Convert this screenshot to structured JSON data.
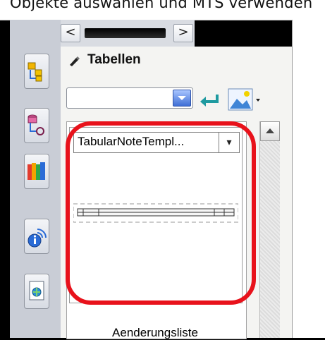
{
  "window": {
    "title": "Objekte auswählen und MTS verwenden"
  },
  "nav": {
    "back_label": "<",
    "forward_label": ">"
  },
  "sidebar": {
    "items": [
      {
        "name": "assembly-navigator-icon"
      },
      {
        "name": "constraint-navigator-icon"
      },
      {
        "name": "library-icon"
      },
      {
        "name": "info-icon"
      },
      {
        "name": "web-browser-icon"
      }
    ]
  },
  "panel": {
    "title": "Tabellen",
    "combo_value": "",
    "back_icon": "return-arrow-icon",
    "image_menu_icon": "image-icon"
  },
  "template_card": {
    "selected": "TabularNoteTempl...",
    "caption": "Aenderungsliste"
  },
  "colors": {
    "highlight": "#e8121b",
    "accent": "#3f6fd6"
  }
}
